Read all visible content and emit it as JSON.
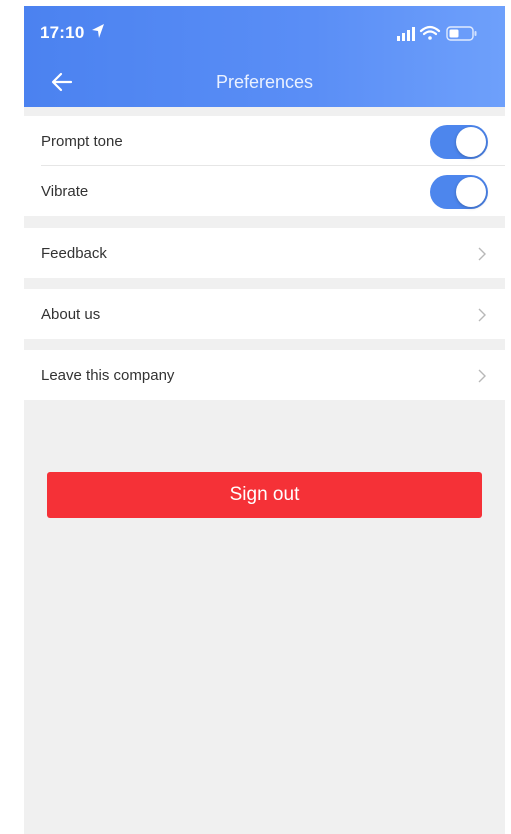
{
  "status_bar": {
    "time": "17:10",
    "location_icon": "location-arrow-icon",
    "signal_icon": "cellular-signal-icon",
    "wifi_icon": "wifi-icon",
    "battery_icon": "battery-icon"
  },
  "header": {
    "title": "Preferences",
    "back_icon": "back-arrow-icon",
    "gradient_start": "#4b82f0",
    "gradient_end": "#6ea0fb"
  },
  "settings": {
    "prompt_tone": {
      "label": "Prompt tone",
      "enabled": true
    },
    "vibrate": {
      "label": "Vibrate",
      "enabled": true
    },
    "feedback": {
      "label": "Feedback"
    },
    "about_us": {
      "label": "About us"
    },
    "leave_company": {
      "label": "Leave this company"
    }
  },
  "colors": {
    "toggle_on": "#4d86ed",
    "sign_out": "#f53137",
    "background": "#f0f0f0"
  },
  "sign_out": {
    "label": "Sign out"
  }
}
